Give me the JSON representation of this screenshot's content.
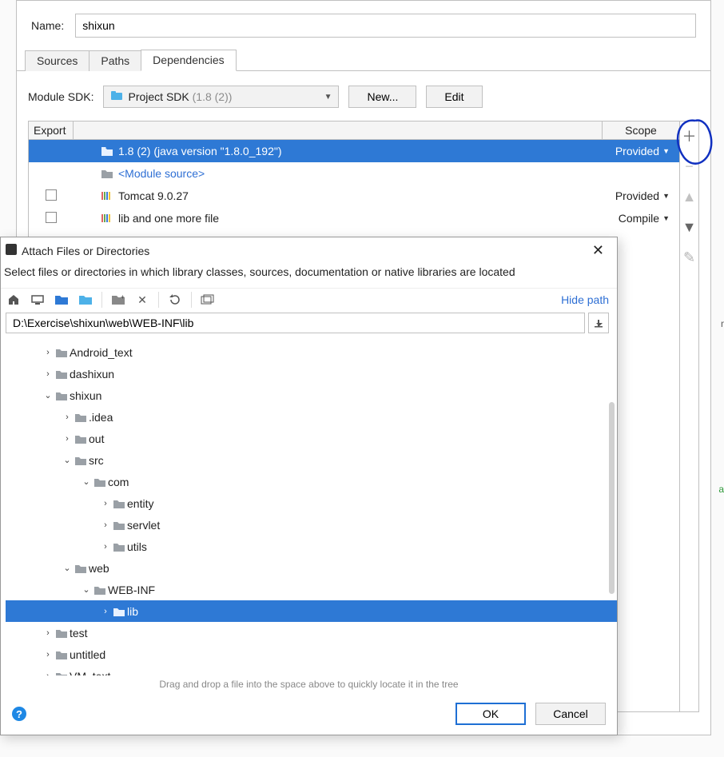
{
  "name_label": "Name:",
  "name_value": "shixun",
  "tabs": [
    "Sources",
    "Paths",
    "Dependencies"
  ],
  "module_sdk": {
    "label": "Module SDK:",
    "selected": "Project SDK",
    "version": "(1.8 (2))",
    "new_btn": "New...",
    "edit_btn": "Edit"
  },
  "deps_header": {
    "export": "Export",
    "scope": "Scope"
  },
  "deps": [
    {
      "name_prefix": "1.8 (2) ",
      "name_main": "(java version \"1.8.0_192\")",
      "scope": "Provided",
      "selected": true,
      "icon": "folder",
      "checkbox": false
    },
    {
      "name_prefix": "",
      "name_main": "<Module source>",
      "scope": "",
      "selected": false,
      "icon": "folder",
      "checkbox": false,
      "link": true
    },
    {
      "name_prefix": "",
      "name_main": "Tomcat 9.0.27",
      "scope": "Provided",
      "selected": false,
      "icon": "lib",
      "checkbox": true
    },
    {
      "name_prefix": "",
      "name_main": "lib and one more file",
      "scope": "Compile",
      "selected": false,
      "icon": "lib",
      "checkbox": true
    }
  ],
  "chooser": {
    "title": "Attach Files or Directories",
    "desc": "Select files or directories in which library classes, sources, documentation or native libraries are located",
    "hide_path": "Hide path",
    "path": "D:\\Exercise\\shixun\\web\\WEB-INF\\lib",
    "drag_hint": "Drag and drop a file into the space above to quickly locate it in the tree",
    "ok": "OK",
    "cancel": "Cancel",
    "tree": [
      {
        "indent": 1,
        "twist": "right",
        "label": "Android_text"
      },
      {
        "indent": 1,
        "twist": "right",
        "label": "dashixun"
      },
      {
        "indent": 1,
        "twist": "down",
        "label": "shixun"
      },
      {
        "indent": 2,
        "twist": "right",
        "label": ".idea"
      },
      {
        "indent": 2,
        "twist": "right",
        "label": "out"
      },
      {
        "indent": 2,
        "twist": "down",
        "label": "src"
      },
      {
        "indent": 3,
        "twist": "down",
        "label": "com"
      },
      {
        "indent": 4,
        "twist": "right",
        "label": "entity"
      },
      {
        "indent": 4,
        "twist": "right",
        "label": "servlet"
      },
      {
        "indent": 4,
        "twist": "right",
        "label": "utils"
      },
      {
        "indent": 2,
        "twist": "down",
        "label": "web"
      },
      {
        "indent": 3,
        "twist": "down",
        "label": "WEB-INF"
      },
      {
        "indent": 4,
        "twist": "right",
        "label": "lib",
        "selected": true
      },
      {
        "indent": 1,
        "twist": "right",
        "label": "test"
      },
      {
        "indent": 1,
        "twist": "right",
        "label": "untitled"
      },
      {
        "indent": 1,
        "twist": "right",
        "label": "VM_text"
      }
    ]
  },
  "aux": {
    "m": "m",
    "ac": "ac"
  }
}
